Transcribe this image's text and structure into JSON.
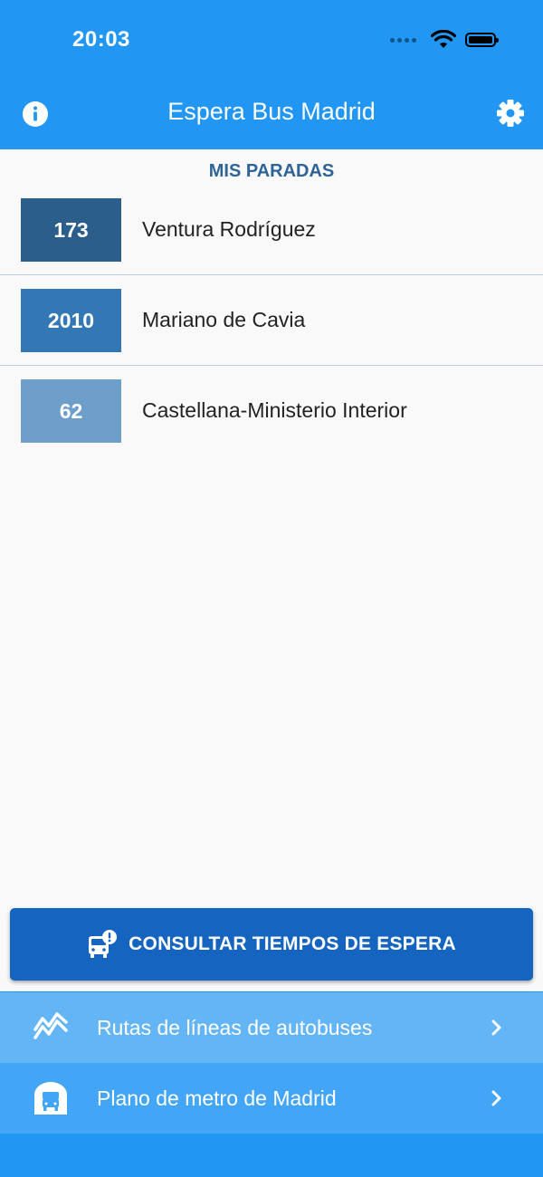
{
  "status_bar": {
    "time": "20:03"
  },
  "header": {
    "title": "Espera Bus Madrid",
    "info_icon": "info-icon",
    "settings_icon": "gear-icon",
    "background_color": "#2196f3"
  },
  "stops_section": {
    "title": "MIS PARADAS",
    "stops": [
      {
        "number": "173",
        "name": "Ventura Rodríguez",
        "color": "#2c5e8c"
      },
      {
        "number": "2010",
        "name": "Mariano de Cavia",
        "color": "#3378b4"
      },
      {
        "number": "62",
        "name": "Castellana-Ministerio Interior",
        "color": "#6e9fcb"
      }
    ]
  },
  "consult_button": {
    "label": "CONSULTAR TIEMPOS DE ESPERA",
    "icon": "bus-alert-icon",
    "color": "#1565c0"
  },
  "nav": {
    "routes": {
      "label": "Rutas de líneas de autobuses",
      "icon": "routes-icon"
    },
    "metro": {
      "label": "Plano de metro de Madrid",
      "icon": "metro-icon"
    }
  }
}
